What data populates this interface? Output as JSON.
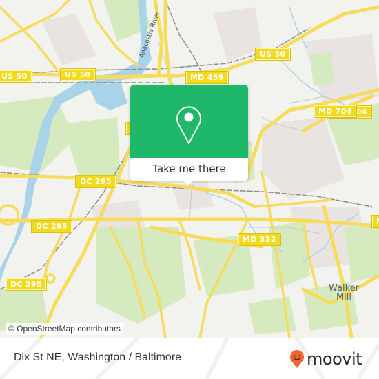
{
  "map": {
    "highway_shields": [
      {
        "id": "us50-west",
        "label": "US 50"
      },
      {
        "id": "us50-mid",
        "label": "US 50"
      },
      {
        "id": "us50-east",
        "label": "US 50"
      },
      {
        "id": "md459",
        "label": "MD 459"
      },
      {
        "id": "md704-north",
        "label": "MD 704"
      },
      {
        "id": "md704-south",
        "label": "MD 704"
      },
      {
        "id": "dc295-north",
        "label": "DC 295"
      },
      {
        "id": "dc295-mid",
        "label": "DC 295"
      },
      {
        "id": "dc295-south",
        "label": "DC 295"
      },
      {
        "id": "md332",
        "label": "MD 332"
      },
      {
        "id": "md-east-edge",
        "label": "M"
      },
      {
        "id": "partial-shield",
        "label": ""
      }
    ],
    "place_labels": {
      "walker_mill": "Walker\nMill",
      "anacostia_river": "Anacostia River"
    },
    "colors": {
      "land": "#f2f2ee",
      "park": "#d6eac0",
      "water": "#a9d3e8",
      "road": "#f6dc5a",
      "urban": "#e9e4e1"
    }
  },
  "popup": {
    "icon": "location-pin-icon",
    "cta_label": "Take me there",
    "accent_color": "#1fb86b"
  },
  "attribution": "© OpenStreetMap contributors",
  "footer": {
    "location_title": "Dix St NE, Washington / Baltimore",
    "brand": {
      "name": "moovit",
      "logo_icon": "moovit-smiley-pin-icon",
      "logo_color": "#f26430"
    }
  }
}
